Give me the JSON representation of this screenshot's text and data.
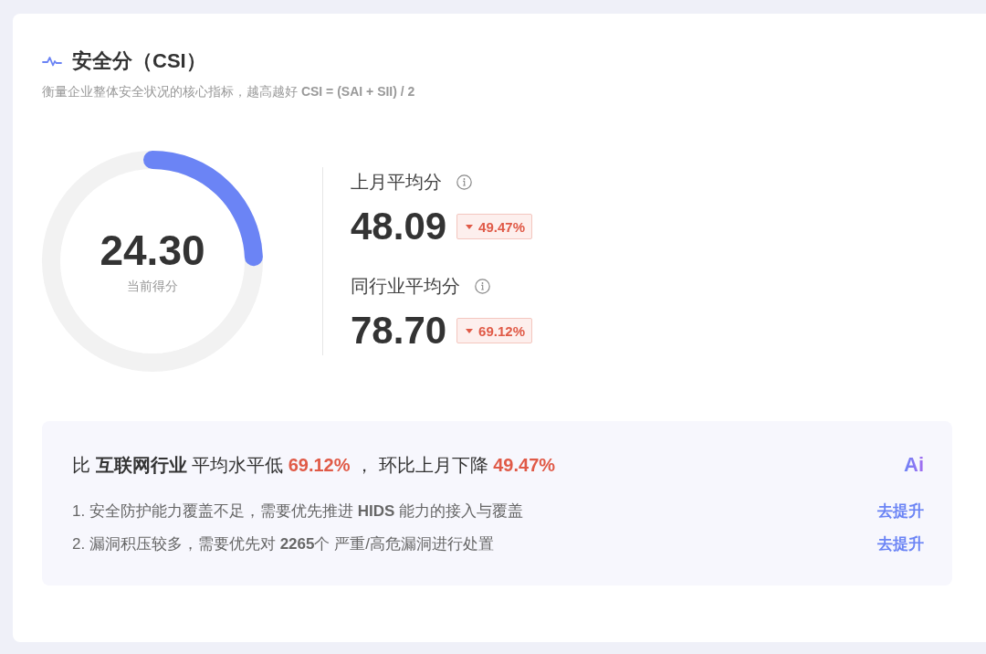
{
  "header": {
    "title": "安全分（CSI）",
    "subtitle": "衡量企业整体安全状况的核心指标，越高越好 **CSI = (SAI + SII) / 2**"
  },
  "gauge": {
    "score": "24.30",
    "label": "当前得分",
    "level": 0.243
  },
  "stats": [
    {
      "label": "上月平均分",
      "value": "48.09",
      "down": true,
      "change": "49.47%"
    },
    {
      "label": "同行业平均分",
      "value": "78.70",
      "down": true,
      "change": "69.12%"
    }
  ],
  "summary": {
    "headline": [
      {
        "kind": "text",
        "text": "比"
      },
      {
        "kind": "strong",
        "text": "互联网行业"
      },
      {
        "kind": "text",
        "text": "平均水平低"
      },
      {
        "kind": "figure",
        "text": "69.12%"
      },
      {
        "kind": "text",
        "text": "，"
      },
      {
        "kind": "text",
        "text": "环比上月下降"
      },
      {
        "kind": "figure",
        "text": "49.47%"
      }
    ],
    "logo": "Ai",
    "items": [
      {
        "text": "1. 安全防护能力覆盖不足，需要优先推进 **HIDS** 能力的接入与覆盖",
        "action": "去提升"
      },
      {
        "text": "2. 漏洞积压较多，需要优先对 **2265**个 严重/高危漏洞进行处置",
        "action": "去提升"
      }
    ]
  }
}
